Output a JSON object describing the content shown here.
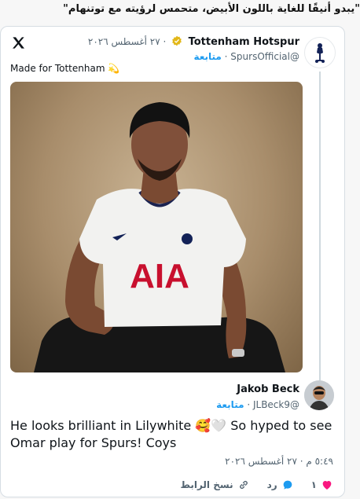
{
  "quote": "\"يبدو أنيقًا للغاية باللون الأبيض، متحمس لرؤيته مع توتنهام\"",
  "tweet": {
    "author_name": "Tottenham Hotspur",
    "handle": "@SpursOfficial",
    "date": "٢٧ أغسطس ٢٠٢٦",
    "follow_label": "متابعة",
    "text": "Made for Tottenham",
    "emoji": "💫"
  },
  "reply": {
    "author_name": "Jakob Beck",
    "handle": "@JLBeck9",
    "follow_label": "متابعة",
    "text": "He looks brilliant in Lilywhite 🥰🤍 So hyped to see Omar play for Spurs! Coys",
    "timestamp": "٥:٤٩ م · ٢٧ أغسطس ٢٠٢٦"
  },
  "actions": {
    "like_count": "١",
    "reply_label": "رد",
    "copy_link_label": "نسخ الرابط"
  },
  "photo": {
    "shirt_sponsor": "AIA"
  },
  "colors": {
    "accent": "#1d9bf0",
    "like": "#f91880",
    "muted": "#536471",
    "verified_gold": "#e2b719"
  },
  "icons": [
    "x-logo-icon",
    "verified-gold-badge-icon",
    "heart-icon",
    "reply-bubble-icon",
    "link-icon",
    "spurs-cockerel-icon"
  ]
}
